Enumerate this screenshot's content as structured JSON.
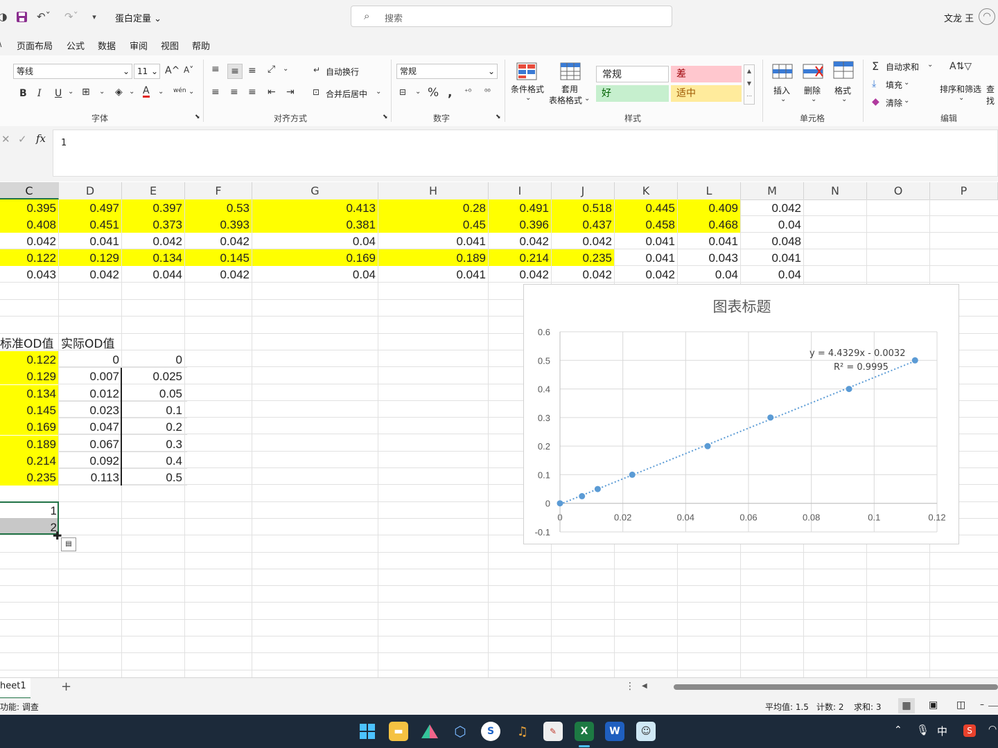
{
  "titlebar": {
    "filename": "蛋白定量",
    "search_placeholder": "搜索",
    "user_name": "文龙 王"
  },
  "menu": [
    "页面布局",
    "公式",
    "数据",
    "审阅",
    "视图",
    "帮助"
  ],
  "ribbon": {
    "font_name": "等线",
    "font_size": "11",
    "font_group": "字体",
    "align_group": "对齐方式",
    "wrap_text": "自动换行",
    "merge_center": "合并后居中",
    "number_format": "常规",
    "number_group": "数字",
    "cond_format": "条件格式",
    "table_format_1": "套用",
    "table_format_2": "表格格式",
    "styles": {
      "normal": "常规",
      "bad": "差",
      "good": "好",
      "neutral": "适中"
    },
    "styles_group": "样式",
    "insert": "插入",
    "delete": "删除",
    "format": "格式",
    "cells_group": "单元格",
    "autosum": "自动求和",
    "fill": "填充",
    "clear": "清除",
    "sort_filter": "排序和筛选",
    "find": "查找",
    "editing_group": "编辑",
    "bold": "B",
    "italic": "I",
    "underline": "U",
    "grow_font": "A^",
    "shrink_font": "A˅",
    "font_color": "A",
    "phonetic": "wén"
  },
  "formula_bar": {
    "fx": "fx",
    "value": "1"
  },
  "columns": [
    "C",
    "D",
    "E",
    "F",
    "G",
    "H",
    "I",
    "J",
    "K",
    "L",
    "M",
    "N",
    "O",
    "P"
  ],
  "rows_top": [
    [
      "0.395",
      "0.497",
      "0.397",
      "0.53",
      "0.413",
      "0.28",
      "0.491",
      "0.518",
      "0.445",
      "0.409",
      "0.042"
    ],
    [
      "0.408",
      "0.451",
      "0.373",
      "0.393",
      "0.381",
      "0.45",
      "0.396",
      "0.437",
      "0.458",
      "0.468",
      "0.04"
    ],
    [
      "0.042",
      "0.041",
      "0.042",
      "0.042",
      "0.04",
      "0.041",
      "0.042",
      "0.042",
      "0.041",
      "0.041",
      "0.048"
    ],
    [
      "0.122",
      "0.129",
      "0.134",
      "0.145",
      "0.169",
      "0.189",
      "0.214",
      "0.235",
      "0.041",
      "0.043",
      "0.041"
    ],
    [
      "0.043",
      "0.042",
      "0.044",
      "0.042",
      "0.04",
      "0.041",
      "0.042",
      "0.042",
      "0.042",
      "0.04",
      "0.04"
    ]
  ],
  "table2_headers": [
    "标准OD值",
    "实际OD值"
  ],
  "table2_rows": [
    [
      "0.122",
      "0",
      "0"
    ],
    [
      "0.129",
      "0.007",
      "0.025"
    ],
    [
      "0.134",
      "0.012",
      "0.05"
    ],
    [
      "0.145",
      "0.023",
      "0.1"
    ],
    [
      "0.169",
      "0.047",
      "0.2"
    ],
    [
      "0.189",
      "0.067",
      "0.3"
    ],
    [
      "0.214",
      "0.092",
      "0.4"
    ],
    [
      "0.235",
      "0.113",
      "0.5"
    ]
  ],
  "selection_cells": [
    "1",
    "2"
  ],
  "chart_data": {
    "type": "scatter",
    "title": "图表标题",
    "x": [
      0,
      0.007,
      0.012,
      0.023,
      0.047,
      0.067,
      0.092,
      0.113
    ],
    "y": [
      0,
      0.025,
      0.05,
      0.1,
      0.2,
      0.3,
      0.4,
      0.5
    ],
    "xlim": [
      0,
      0.12
    ],
    "ylim": [
      -0.1,
      0.6
    ],
    "x_ticks": [
      "0",
      "0.02",
      "0.04",
      "0.06",
      "0.08",
      "0.1",
      "0.12"
    ],
    "y_ticks": [
      "-0.1",
      "0",
      "0.1",
      "0.2",
      "0.3",
      "0.4",
      "0.5",
      "0.6"
    ],
    "trendline": {
      "type": "linear",
      "slope": 4.4329,
      "intercept": -0.0032
    },
    "equation": "y = 4.4329x - 0.0032",
    "r2": "R² = 0.9995",
    "grid": true,
    "marker_color": "#5b9bd5"
  },
  "sheet": {
    "tab": "heet1",
    "add": "+"
  },
  "status": {
    "left": "功能: 调查",
    "average": "平均值: 1.5",
    "count": "计数: 2",
    "sum": "求和: 3"
  },
  "taskbar": {
    "ime": "中"
  }
}
